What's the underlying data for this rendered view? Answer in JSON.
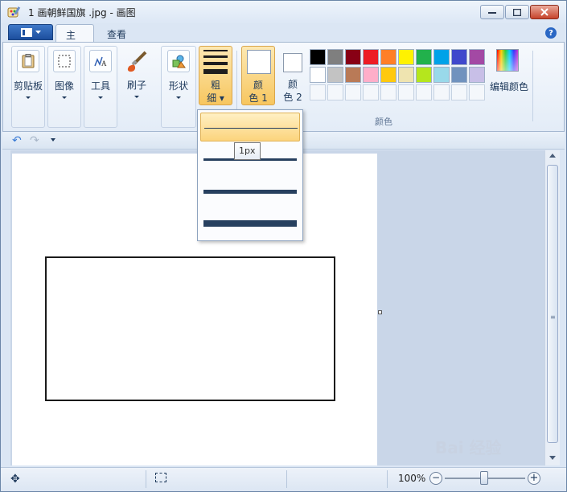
{
  "window": {
    "title": "1 画朝鲜国旗 .jpg - 画图"
  },
  "tabs": {
    "home": "主页",
    "view": "查看"
  },
  "ribbon": {
    "clipboard": "剪贴板",
    "image": "图像",
    "tools": "工具",
    "brushes": "刷子",
    "shapes": "形状",
    "size_line1": "粗",
    "size_line2": "细",
    "color1_line1": "颜",
    "color1_line2": "色 1",
    "color2_line1": "颜",
    "color2_line2": "色 2",
    "edit_colors": "编辑颜色",
    "colors_group": "颜色"
  },
  "palette": {
    "row1": [
      "#000000",
      "#7f7f7f",
      "#880015",
      "#ed1c24",
      "#ff7f27",
      "#fff200",
      "#22b14c",
      "#00a2e8",
      "#3f48cc",
      "#a349a4"
    ],
    "row2": [
      "#ffffff",
      "#c3c3c3",
      "#b97a57",
      "#ffaec9",
      "#ffc90e",
      "#efe4b0",
      "#b5e61d",
      "#99d9ea",
      "#7092be",
      "#c8bfe7"
    ]
  },
  "size_menu": {
    "tooltip": "1px",
    "thickness": [
      1,
      3,
      5,
      8
    ]
  },
  "statusbar": {
    "zoom": "100%",
    "zoom_minus": "−",
    "zoom_plus": "+"
  },
  "colors": {
    "accent": "#f7c65f",
    "canvas": "#ffffff",
    "workspace": "#c9d6e8"
  },
  "watermark": "Bai 经验"
}
